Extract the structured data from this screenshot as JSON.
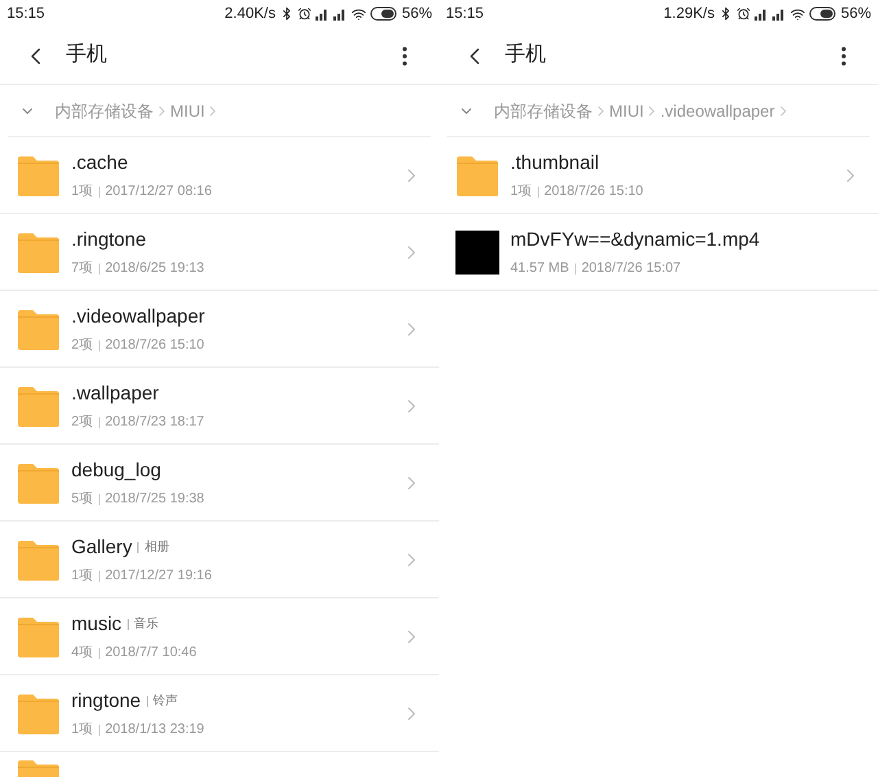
{
  "panels": [
    {
      "status_bar": {
        "time": "15:15",
        "speed": "2.40K/s",
        "battery": "56%"
      },
      "header": {
        "title": "手机"
      },
      "breadcrumb": [
        "内部存储设备",
        "MIUI"
      ],
      "items": [
        {
          "kind": "folder",
          "name": ".cache",
          "meta": "1项",
          "date": "2017/12/27 08:16"
        },
        {
          "kind": "folder",
          "name": ".ringtone",
          "meta": "7项",
          "date": "2018/6/25 19:13"
        },
        {
          "kind": "folder",
          "name": ".videowallpaper",
          "meta": "2项",
          "date": "2018/7/26 15:10"
        },
        {
          "kind": "folder",
          "name": ".wallpaper",
          "meta": "2项",
          "date": "2018/7/23 18:17"
        },
        {
          "kind": "folder",
          "name": "debug_log",
          "meta": "5项",
          "date": "2018/7/25 19:38"
        },
        {
          "kind": "folder",
          "name": "Gallery",
          "tag": "相册",
          "meta": "1项",
          "date": "2017/12/27 19:16"
        },
        {
          "kind": "folder",
          "name": "music",
          "tag": "音乐",
          "meta": "4项",
          "date": "2018/7/7 10:46"
        },
        {
          "kind": "folder",
          "name": "ringtone",
          "tag": "铃声",
          "meta": "1项",
          "date": "2018/1/13 23:19"
        },
        {
          "kind": "partial"
        }
      ]
    },
    {
      "status_bar": {
        "time": "15:15",
        "speed": "1.29K/s",
        "battery": "56%"
      },
      "header": {
        "title": "手机"
      },
      "breadcrumb": [
        "内部存储设备",
        "MIUI",
        ".videowallpaper"
      ],
      "items": [
        {
          "kind": "folder",
          "name": ".thumbnail",
          "meta": "1项",
          "date": "2018/7/26 15:10"
        },
        {
          "kind": "video",
          "name": "mDvFYw==&dynamic=1.mp4",
          "meta": "41.57 MB",
          "date": "2018/7/26 15:07"
        }
      ]
    }
  ]
}
